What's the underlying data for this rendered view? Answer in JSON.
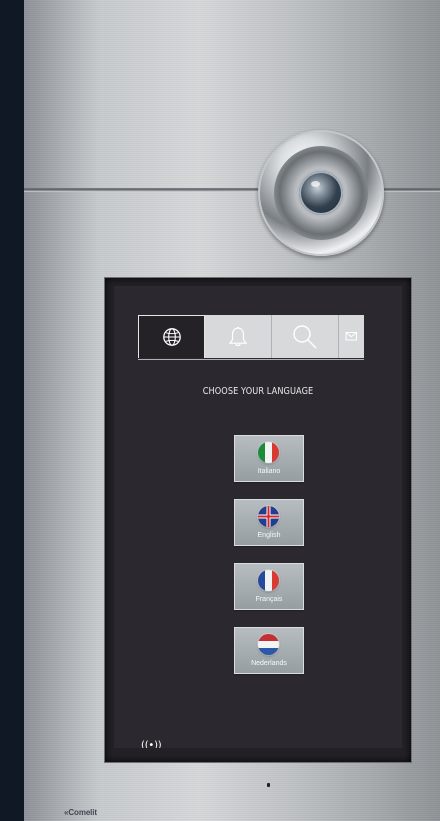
{
  "tabs": [
    {
      "icon": "globe-icon",
      "active": true
    },
    {
      "icon": "bell-icon",
      "active": false
    },
    {
      "icon": "search-icon",
      "active": false
    },
    {
      "icon": "mail-icon",
      "active": false
    }
  ],
  "screen": {
    "prompt": "CHOOSE YOUR LANGUAGE"
  },
  "languages": [
    {
      "label": "Italiano",
      "flag": "italian-flag-icon"
    },
    {
      "label": "English",
      "flag": "uk-flag-icon"
    },
    {
      "label": "Français",
      "flag": "french-flag-icon"
    },
    {
      "label": "Nederlands",
      "flag": "dutch-flag-icon"
    }
  ],
  "status": {
    "indicator": "((•))"
  },
  "brand": "«Comelit",
  "colors": {
    "screen_background": "#2c2830",
    "active_tab": "#242127",
    "inactive_tab": "#d7d9db",
    "language_button": "#a8aeb1"
  }
}
